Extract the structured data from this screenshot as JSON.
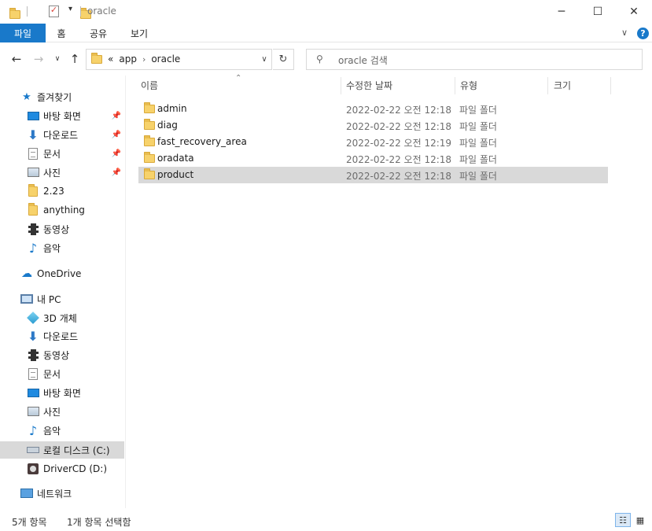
{
  "window": {
    "title": "oracle",
    "minimize_icon": "─",
    "maximize_icon": "☐",
    "close_icon": "✕"
  },
  "ribbon": {
    "tabs": [
      {
        "label": "파일"
      },
      {
        "label": "홈"
      },
      {
        "label": "공유"
      },
      {
        "label": "보기"
      }
    ]
  },
  "navigation": {
    "breadcrumb": [
      "app",
      "oracle"
    ],
    "breadcrumb_overflow": "«",
    "search_placeholder": "oracle 검색"
  },
  "sidebar": {
    "quick_access_label": "즐겨찾기",
    "quick_access": [
      {
        "label": "바탕 화면",
        "icon": "desktop-icon",
        "pinned": true
      },
      {
        "label": "다운로드",
        "icon": "download-icon",
        "pinned": true
      },
      {
        "label": "문서",
        "icon": "document-icon",
        "pinned": true
      },
      {
        "label": "사진",
        "icon": "pictures-icon",
        "pinned": true
      },
      {
        "label": "2.23",
        "icon": "folder-icon",
        "pinned": false
      },
      {
        "label": "anything",
        "icon": "folder-icon",
        "pinned": false
      },
      {
        "label": "동영상",
        "icon": "video-icon",
        "pinned": false
      },
      {
        "label": "음악",
        "icon": "music-icon",
        "pinned": false
      }
    ],
    "onedrive_label": "OneDrive",
    "this_pc_label": "내 PC",
    "this_pc": [
      {
        "label": "3D 개체",
        "icon": "3d-objects-icon"
      },
      {
        "label": "다운로드",
        "icon": "download-icon"
      },
      {
        "label": "동영상",
        "icon": "video-icon"
      },
      {
        "label": "문서",
        "icon": "document-icon"
      },
      {
        "label": "바탕 화면",
        "icon": "desktop-icon"
      },
      {
        "label": "사진",
        "icon": "pictures-icon"
      },
      {
        "label": "음악",
        "icon": "music-icon"
      },
      {
        "label": "로컬 디스크 (C:)",
        "icon": "drive-icon",
        "selected": true
      },
      {
        "label": "DriverCD (D:)",
        "icon": "cd-drive-icon"
      }
    ],
    "network_label": "네트워크"
  },
  "file_list": {
    "columns": {
      "name": "이름",
      "modified": "수정한 날짜",
      "type": "유형",
      "size": "크기"
    },
    "rows": [
      {
        "name": "admin",
        "modified": "2022-02-22 오전 12:18",
        "type": "파일 폴더",
        "size": ""
      },
      {
        "name": "diag",
        "modified": "2022-02-22 오전 12:18",
        "type": "파일 폴더",
        "size": ""
      },
      {
        "name": "fast_recovery_area",
        "modified": "2022-02-22 오전 12:19",
        "type": "파일 폴더",
        "size": ""
      },
      {
        "name": "oradata",
        "modified": "2022-02-22 오전 12:18",
        "type": "파일 폴더",
        "size": ""
      },
      {
        "name": "product",
        "modified": "2022-02-22 오전 12:18",
        "type": "파일 폴더",
        "size": "",
        "selected": true
      }
    ]
  },
  "status": {
    "item_count": "5개 항목",
    "selection": "1개 항목 선택함"
  },
  "colors": {
    "accent": "#1979ca",
    "folder": "#f7d26b",
    "selection": "#d9d9d9"
  }
}
